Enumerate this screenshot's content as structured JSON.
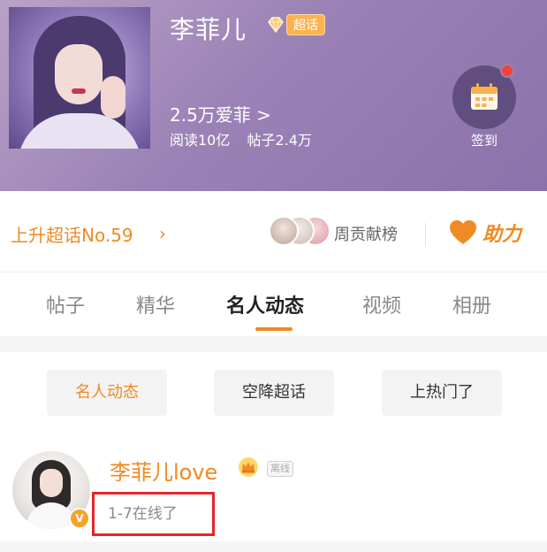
{
  "header": {
    "topic_name": "李菲儿",
    "super_badge": "超话",
    "fans": "2.5万爱菲 >",
    "reads": "阅读10亿",
    "posts": "帖子2.4万",
    "checkin_label": "签到"
  },
  "rank": {
    "text": "上升超话No.59",
    "chevron": "›",
    "contrib_label": "周贡献榜",
    "help_label": "助力"
  },
  "tabs": [
    {
      "label": "帖子"
    },
    {
      "label": "精华"
    },
    {
      "label": "名人动态"
    },
    {
      "label": "视频"
    },
    {
      "label": "相册"
    }
  ],
  "filters": [
    {
      "label": "名人动态"
    },
    {
      "label": "空降超话"
    },
    {
      "label": "上热门了"
    }
  ],
  "post": {
    "username": "李菲儿love",
    "offline_badge": "离线",
    "subtitle": "1-7在线了",
    "verified_badge": "V"
  },
  "colors": {
    "accent": "#f08a24",
    "header_bg": "#9b82b6",
    "highlight_border": "#e8242b"
  }
}
